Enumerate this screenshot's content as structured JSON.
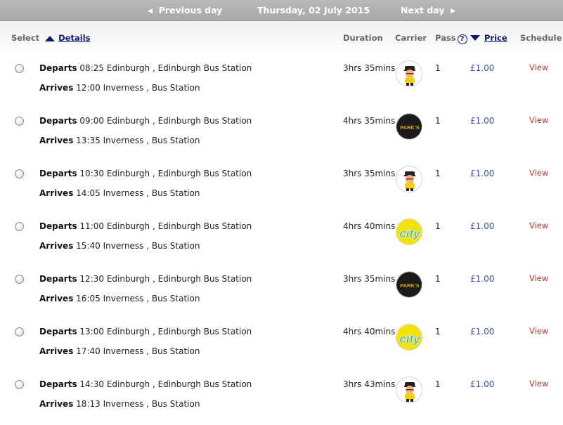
{
  "nav": {
    "previous_label": "Previous day",
    "date_label": "Thursday, 02 July 2015",
    "next_label": "Next day"
  },
  "header": {
    "select": "Select",
    "details": "Details",
    "duration": "Duration",
    "carrier": "Carrier",
    "pass": "Pass",
    "help": "?",
    "price": "Price",
    "schedule": "Schedule"
  },
  "labels": {
    "departs": "Departs",
    "arrives": "Arrives",
    "view": "View"
  },
  "carriers": {
    "mascot": "bus-driver-mascot-logo",
    "parks": "PARK'S",
    "city": "city"
  },
  "rows": [
    {
      "depart_time": "08:25",
      "depart_place": "Edinburgh , Edinburgh Bus Station",
      "arrive_time": "12:00",
      "arrive_place": "Inverness , Bus Station",
      "duration": "3hrs 35mins",
      "carrier": "mascot",
      "pass": "1",
      "price": "£1.00",
      "view": "View"
    },
    {
      "depart_time": "09:00",
      "depart_place": "Edinburgh , Edinburgh Bus Station",
      "arrive_time": "13:35",
      "arrive_place": "Inverness , Bus Station",
      "duration": "4hrs 35mins",
      "carrier": "parks",
      "pass": "1",
      "price": "£1.00",
      "view": "View"
    },
    {
      "depart_time": "10:30",
      "depart_place": "Edinburgh , Edinburgh Bus Station",
      "arrive_time": "14:05",
      "arrive_place": "Inverness , Bus Station",
      "duration": "3hrs 35mins",
      "carrier": "mascot",
      "pass": "1",
      "price": "£1.00",
      "view": "View"
    },
    {
      "depart_time": "11:00",
      "depart_place": "Edinburgh , Edinburgh Bus Station",
      "arrive_time": "15:40",
      "arrive_place": "Inverness , Bus Station",
      "duration": "4hrs 40mins",
      "carrier": "city",
      "pass": "1",
      "price": "£1.00",
      "view": "View"
    },
    {
      "depart_time": "12:30",
      "depart_place": "Edinburgh , Edinburgh Bus Station",
      "arrive_time": "16:05",
      "arrive_place": "Inverness , Bus Station",
      "duration": "3hrs 35mins",
      "carrier": "parks",
      "pass": "1",
      "price": "£1.00",
      "view": "View"
    },
    {
      "depart_time": "13:00",
      "depart_place": "Edinburgh , Edinburgh Bus Station",
      "arrive_time": "17:40",
      "arrive_place": "Inverness , Bus Station",
      "duration": "4hrs 40mins",
      "carrier": "city",
      "pass": "1",
      "price": "£1.00",
      "view": "View"
    },
    {
      "depart_time": "14:30",
      "depart_place": "Edinburgh , Edinburgh Bus Station",
      "arrive_time": "18:13",
      "arrive_place": "Inverness , Bus Station",
      "duration": "3hrs 43mins",
      "carrier": "mascot",
      "pass": "1",
      "price": "£1.00",
      "view": "View"
    }
  ],
  "colors": {
    "accent_navy": "#0d1a6e",
    "price_blue": "#3a4ea8",
    "view_red": "#b0392c",
    "city_yellow": "#f2e300",
    "city_blue": "#1aa6e0"
  }
}
